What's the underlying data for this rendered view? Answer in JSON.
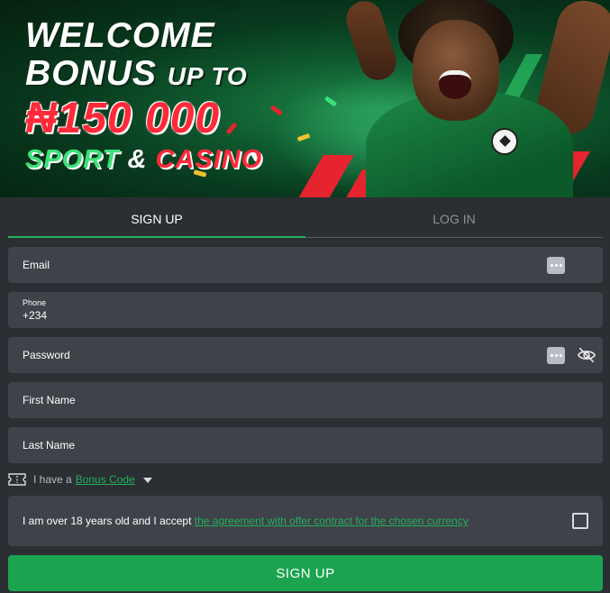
{
  "banner": {
    "line1": "WELCOME",
    "line2_main": "BONUS",
    "line2_small": "UP TO",
    "amount": "₦150 000",
    "sport": "SPORT",
    "amp": "&",
    "casino": "CASINO"
  },
  "tabs": {
    "signup": "SIGN UP",
    "login": "LOG IN",
    "active": "signup"
  },
  "form": {
    "email_label": "Email",
    "phone_label": "Phone",
    "phone_value": "+234",
    "password_label": "Password",
    "first_name_label": "First Name",
    "last_name_label": "Last Name"
  },
  "bonus": {
    "prefix": "I have a",
    "link": "Bonus Code"
  },
  "agreement": {
    "text": "I am over 18 years old and I accept ",
    "link": "the agreement with offer contract for the chosen currency",
    "checked": false
  },
  "submit_label": "SIGN UP",
  "colors": {
    "accent_green": "#1ca34f",
    "link_green": "#22b05a",
    "background": "#2b2e33",
    "field_bg": "#3f4248",
    "banner_red": "#ff2a3a"
  },
  "icons": {
    "autofill": "autofill-dots-icon",
    "password_toggle": "eye-slash-icon",
    "bonus": "ticket-icon",
    "dropdown": "caret-down-icon"
  }
}
